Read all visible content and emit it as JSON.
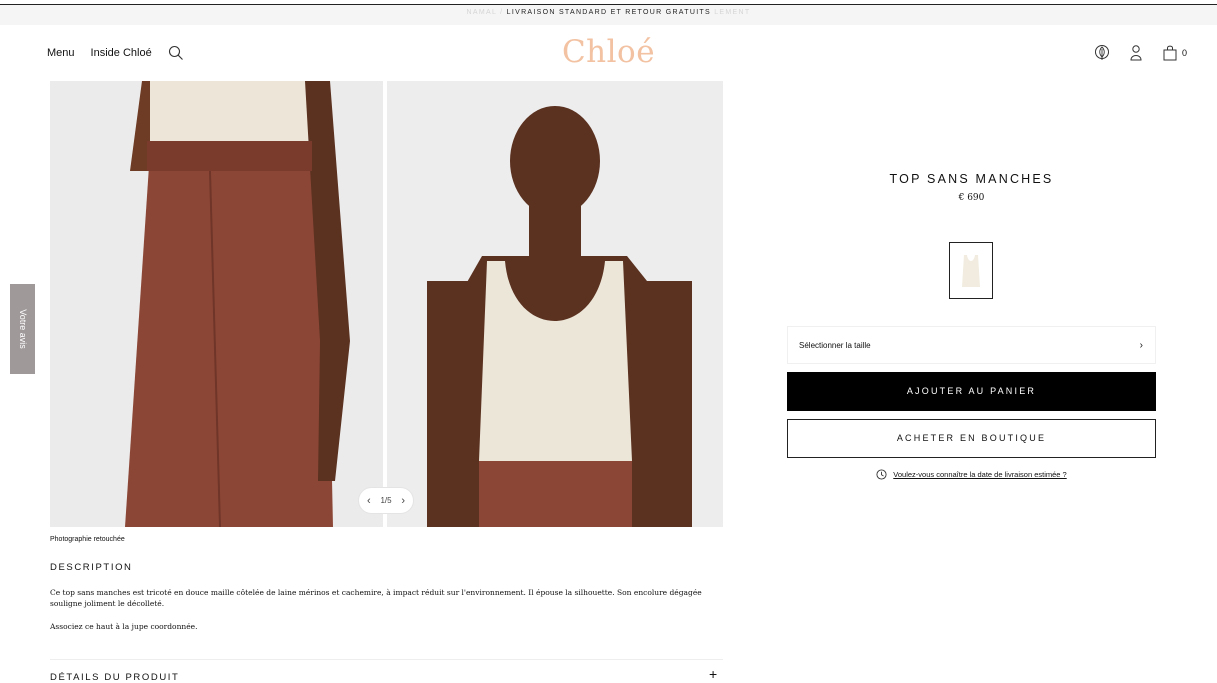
{
  "banner": {
    "left_fragment": "NAMAL /",
    "text": "LIVRAISON STANDARD ET RETOUR GRATUITS",
    "right_fragment": "LEMENT"
  },
  "header": {
    "menu_label": "Menu",
    "inside_label": "Inside Chloé",
    "logo_text": "Chloé",
    "cart_count": "0",
    "logo_color": "#f2c2a2"
  },
  "feedback": {
    "label": "Votre avis"
  },
  "gallery": {
    "pager_prev": "‹",
    "pager_text": "1/5",
    "pager_next": "›",
    "current_image": 1,
    "total_images": 5
  },
  "caption": "Photographie retouchée",
  "description": {
    "title": "DESCRIPTION",
    "text": "Ce top sans manches est tricoté en douce maille côtelée de laine mérinos et cachemire, à impact réduit sur l'environnement. Il épouse la silhouette. Son encolure dégagée souligne joliment le décolleté.",
    "text2": "Associez ce haut à la jupe coordonnée."
  },
  "details": {
    "title": "DÉTAILS DU PRODUIT",
    "toggle": "+"
  },
  "product": {
    "name": "TOP SANS MANCHES",
    "price": "€ 690",
    "size_label": "Sélectionner la taille",
    "size_chevron": "›",
    "add_to_cart": "AJOUTER AU PANIER",
    "buy_in_store": "ACHETER EN BOUTIQUE",
    "delivery_link": "Voulez-vous connaître la date de livraison estimée ?"
  },
  "icons": [
    "search-icon",
    "leaf-icon",
    "user-icon",
    "bag-icon",
    "clock-icon",
    "chevron-right-icon",
    "plus-icon"
  ]
}
